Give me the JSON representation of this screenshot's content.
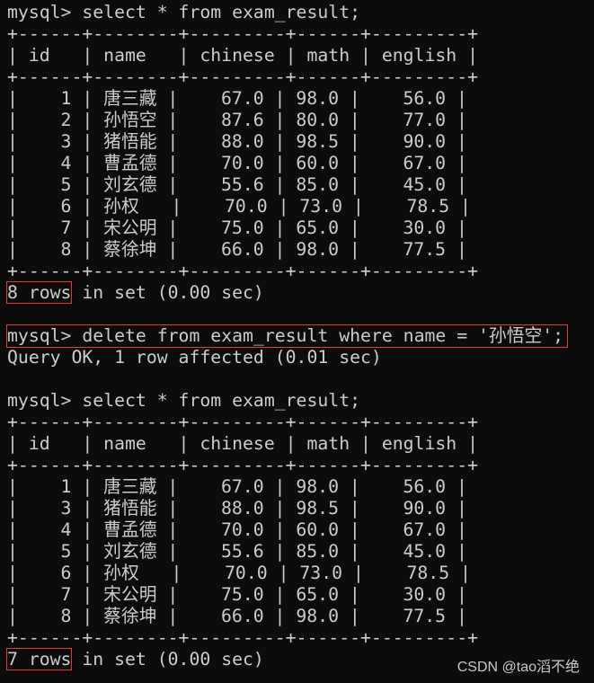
{
  "terminal": {
    "prompt": "mysql> ",
    "commands": {
      "select1": "select * from exam_result;",
      "delete": "delete from exam_result where name = '孙悟空';",
      "select2": "select * from exam_result;"
    },
    "columns": [
      "id",
      "name",
      "chinese",
      "math",
      "english"
    ],
    "table1_rows": [
      [
        "1",
        "唐三藏",
        "67.0",
        "98.0",
        "56.0"
      ],
      [
        "2",
        "孙悟空",
        "87.6",
        "80.0",
        "77.0"
      ],
      [
        "3",
        "猪悟能",
        "88.0",
        "98.5",
        "90.0"
      ],
      [
        "4",
        "曹孟德",
        "70.0",
        "60.0",
        "67.0"
      ],
      [
        "5",
        "刘玄德",
        "55.6",
        "85.0",
        "45.0"
      ],
      [
        "6",
        "孙权",
        "70.0",
        "73.0",
        "78.5"
      ],
      [
        "7",
        "宋公明",
        "75.0",
        "65.0",
        "30.0"
      ],
      [
        "8",
        "蔡徐坤",
        "66.0",
        "98.0",
        "77.5"
      ]
    ],
    "table2_rows": [
      [
        "1",
        "唐三藏",
        "67.0",
        "98.0",
        "56.0"
      ],
      [
        "3",
        "猪悟能",
        "88.0",
        "98.5",
        "90.0"
      ],
      [
        "4",
        "曹孟德",
        "70.0",
        "60.0",
        "67.0"
      ],
      [
        "5",
        "刘玄德",
        "55.6",
        "85.0",
        "45.0"
      ],
      [
        "6",
        "孙权",
        "70.0",
        "73.0",
        "78.5"
      ],
      [
        "7",
        "宋公明",
        "75.0",
        "65.0",
        "30.0"
      ],
      [
        "8",
        "蔡徐坤",
        "66.0",
        "98.0",
        "77.5"
      ]
    ],
    "result1": {
      "count": "8 rows",
      "rest": " in set (0.00 sec)"
    },
    "delete_result": "Query OK, 1 row affected (0.01 sec)",
    "result2": {
      "count": "7 rows",
      "rest": " in set (0.00 sec)"
    }
  },
  "watermark": "CSDN @tao滔不绝",
  "colors": {
    "background": "#0c0c0c",
    "text": "#cccccc",
    "highlight": "#e23b3b"
  }
}
